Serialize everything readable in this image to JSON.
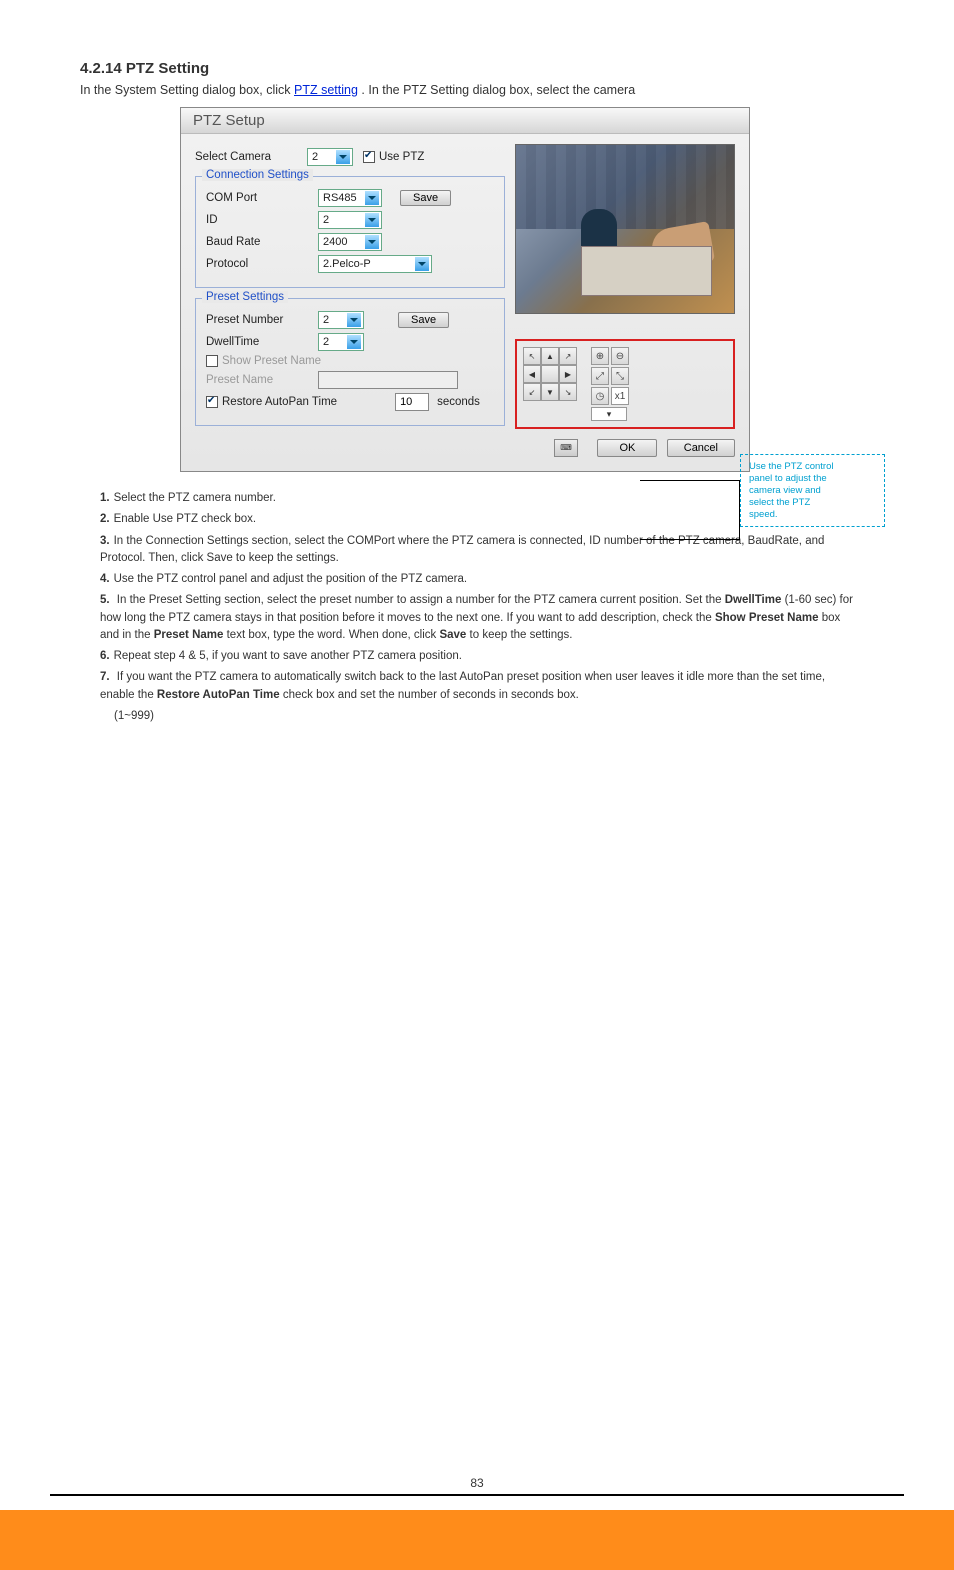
{
  "page": {
    "title": "4.2.14 PTZ Setting",
    "intro_before": "In the System Setting dialog box, click ",
    "intro_link": "PTZ setting",
    "intro_after": ". In the PTZ Setting dialog box, select the camera"
  },
  "dialog": {
    "title": "PTZ Setup",
    "select_camera_label": "Select Camera",
    "select_camera_value": "2",
    "use_ptz_label": "Use PTZ",
    "connection_legend": "Connection Settings",
    "com_port_label": "COM Port",
    "com_port_value": "RS485",
    "save_label": "Save",
    "id_label": "ID",
    "id_value": "2",
    "baud_label": "Baud Rate",
    "baud_value": "2400",
    "protocol_label": "Protocol",
    "protocol_value": "2.Pelco-P",
    "preset_legend": "Preset Settings",
    "preset_number_label": "Preset Number",
    "preset_number_value": "2",
    "dwell_label": "DwellTime",
    "dwell_value": "2",
    "show_preset_label": "Show Preset Name",
    "preset_name_label": "Preset Name",
    "restore_label": "Restore AutoPan Time",
    "restore_value": "10",
    "restore_unit": "seconds",
    "ptz_speed_value": "x1",
    "ok_label": "OK",
    "cancel_label": "Cancel"
  },
  "callout": {
    "line1": "Use the PTZ control",
    "line2": "panel to adjust the",
    "line3": "camera view and",
    "line4": "select the PTZ",
    "line5": "speed."
  },
  "steps": {
    "s1": "Select the PTZ camera number.",
    "s2": "Enable Use PTZ check box.",
    "s3": "In the Connection Settings section, select the COMPort where the PTZ camera is connected, ID number of the PTZ camera, BaudRate, and Protocol. Then, click Save to keep the settings.",
    "s4": "Use the PTZ control panel and adjust the position of the PTZ camera.",
    "s5_before": "In the Preset Setting section, select the preset number to assign a number for the PTZ camera current position. Set the ",
    "s5_dwell": "DwellTime",
    "s5_mid": " (1-60 sec) for how long the PTZ camera stays in that position before it moves to the next one. If you want to add description, check the ",
    "s5_show": "Show Preset Name",
    "s5_mid2": " box and in the ",
    "s5_pname": "Preset Name",
    "s5_mid3": " text box, type the word. When done, click ",
    "s5_save": "Save",
    "s5_after": " to keep the settings.",
    "s6": "Repeat step 4 & 5, if you want to save another PTZ camera position.",
    "s7_before": "If you want the PTZ camera to automatically switch back to the last AutoPan preset position when user leaves it idle more than the set time, enable the ",
    "s7_rest": "Restore AutoPan Time",
    "s7_after": " check box and set the number of seconds in seconds box.",
    "s_note": "(1~999)"
  },
  "footer": {
    "page_number": "83"
  }
}
